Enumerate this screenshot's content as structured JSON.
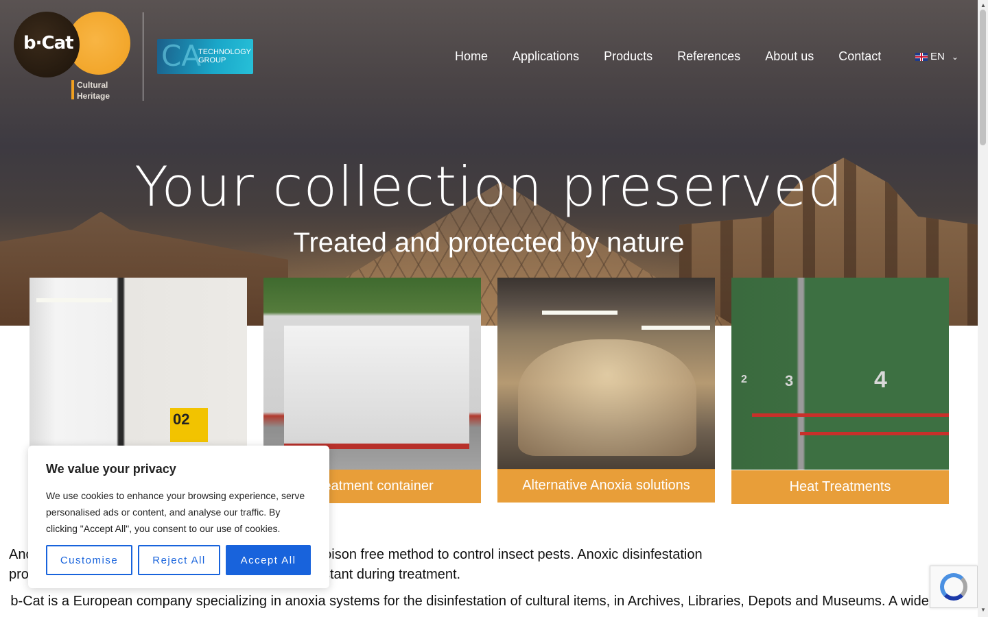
{
  "logo": {
    "brand": "b·Cat",
    "sub_line1": "Cultural",
    "sub_line2": "Heritage",
    "partner_line1": "TECHNOLOGY",
    "partner_line2": "GROUP",
    "partner_mark": "CA"
  },
  "nav": {
    "items": [
      "Home",
      "Applications",
      "Products",
      "References",
      "About us",
      "Contact"
    ],
    "language": "EN"
  },
  "hero": {
    "title": "Your collection preserved",
    "subtitle": "Treated and protected by nature"
  },
  "cards": [
    {
      "label": "",
      "sign_text": "02"
    },
    {
      "label": "Treatment container"
    },
    {
      "label": "Alternative Anoxia solutions"
    },
    {
      "label": "Heat Treatments",
      "numbers": [
        "2",
        "3",
        "4"
      ]
    }
  ],
  "body": {
    "para1_line1": "Anoxia has been used by museums as a safe and poison free method to control insect pests. Anoxic disinfestation",
    "para1_line2": "process where the climatic parameters are kept constant during treatment.",
    "para2_line1": "b-Cat is a European company specializing in anoxia systems for the disinfestation of cultural items, in Archives, Libraries, Depots and Museums. A wide range"
  },
  "cookie": {
    "title": "We value your privacy",
    "description": "We use cookies to enhance your browsing experience, serve personalised ads or content, and analyse our traffic. By clicking \"Accept All\", you consent to our use of cookies.",
    "customise": "Customise",
    "reject": "Reject All",
    "accept": "Accept All"
  },
  "colors": {
    "accent": "#e6962a",
    "button_blue": "#1863dc"
  }
}
